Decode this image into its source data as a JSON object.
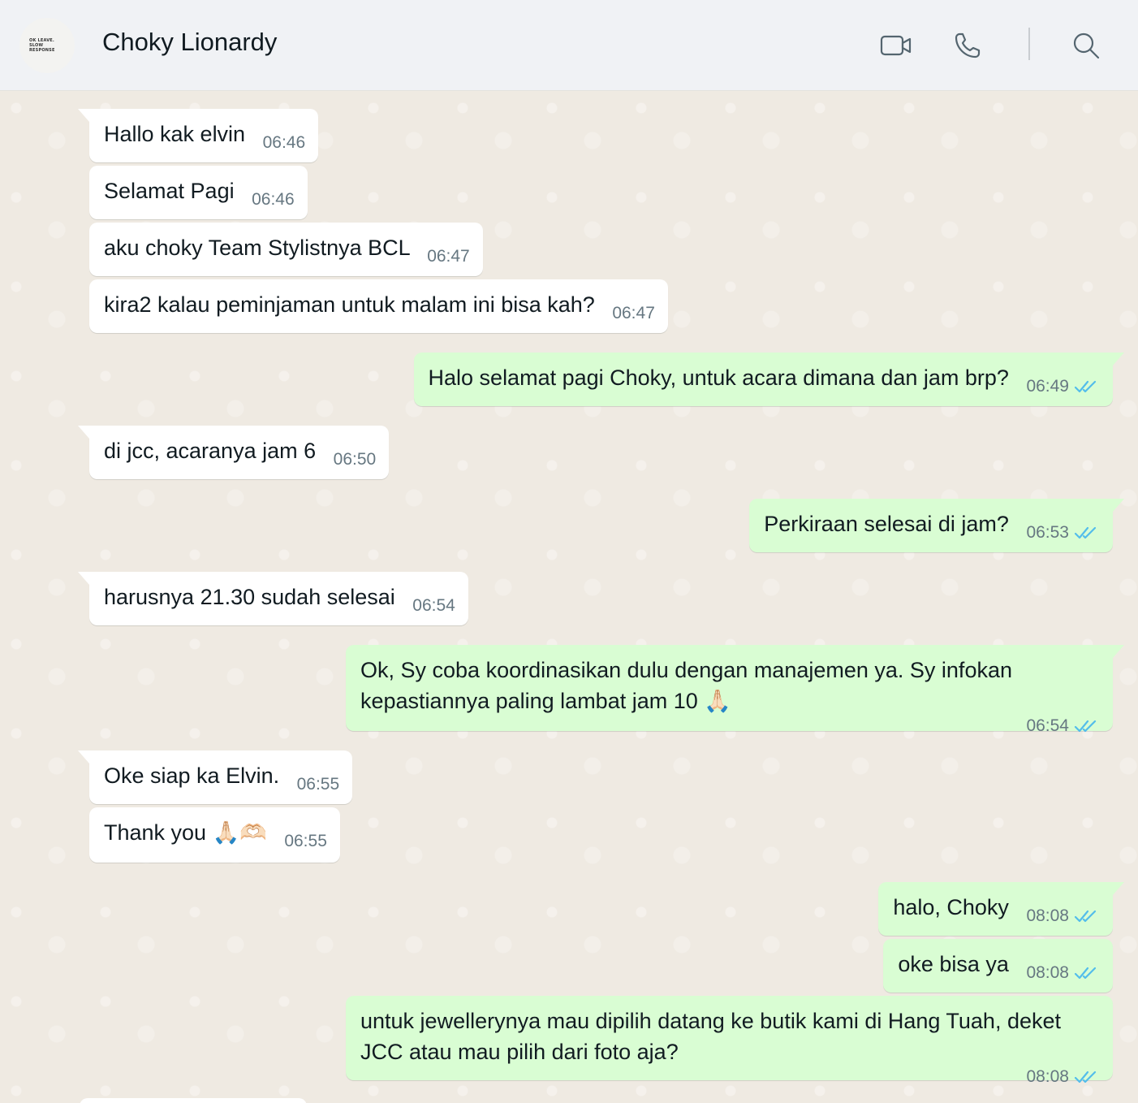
{
  "header": {
    "contact_name": "Choky Lionardy",
    "avatar_text_line1": "OK LEAVE.",
    "avatar_text_line2": "SLOW RESPONSE"
  },
  "icons": {
    "video": "video-call-icon",
    "phone": "voice-call-icon",
    "search": "search-icon",
    "read_receipt": "double-check-icon"
  },
  "colors": {
    "incoming_bubble": "#ffffff",
    "outgoing_bubble": "#d9fdd3",
    "read_tick": "#53bdeb",
    "chat_background": "#efeae2",
    "header_background": "#f0f2f5"
  },
  "messages": [
    {
      "dir": "in",
      "text": "Hallo kak elvin",
      "time": "06:46"
    },
    {
      "dir": "in",
      "text": "Selamat Pagi",
      "time": "06:46"
    },
    {
      "dir": "in",
      "text": "aku choky Team Stylistnya BCL",
      "time": "06:47"
    },
    {
      "dir": "in",
      "text": "kira2 kalau peminjaman untuk malam ini bisa kah?",
      "time": "06:47"
    },
    {
      "dir": "out",
      "text": "Halo selamat pagi Choky, untuk acara dimana dan jam brp?",
      "time": "06:49"
    },
    {
      "dir": "in",
      "text": "di jcc, acaranya jam 6",
      "time": "06:50"
    },
    {
      "dir": "out",
      "text": "Perkiraan selesai di jam?",
      "time": "06:53"
    },
    {
      "dir": "in",
      "text": "harusnya 21.30 sudah selesai",
      "time": "06:54"
    },
    {
      "dir": "out",
      "text": "Ok, Sy coba koordinasikan dulu dengan manajemen ya. Sy infokan kepastiannya paling lambat jam 10 🙏🏻",
      "time": "06:54"
    },
    {
      "dir": "in",
      "text": "Oke siap ka Elvin.",
      "time": "06:55"
    },
    {
      "dir": "in",
      "text": "Thank you 🙏🏻🫶🏻",
      "time": "06:55"
    },
    {
      "dir": "out",
      "text": "halo, Choky",
      "time": "08:08"
    },
    {
      "dir": "out",
      "text": "oke bisa ya",
      "time": "08:08"
    },
    {
      "dir": "out",
      "text": "untuk jewellerynya mau dipilih datang ke butik kami di Hang Tuah, deket JCC atau mau pilih dari foto aja?",
      "time": "08:08"
    }
  ]
}
